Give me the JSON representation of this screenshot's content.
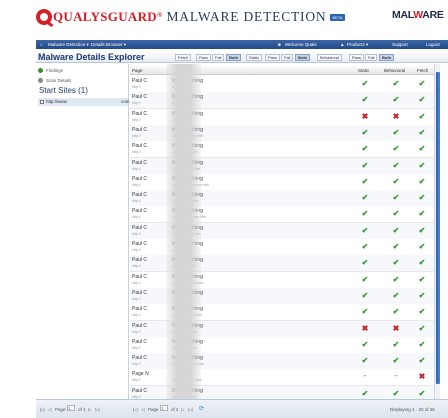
{
  "brand": {
    "name": "QUALYSGUARD",
    "reg": "®",
    "product": "MALWARE DETECTION",
    "beta": "BETA",
    "malware_logo_left": "MAL",
    "malware_logo_mid": "W",
    "malware_logo_right": "ARE"
  },
  "nav": {
    "home_label": "Malware Detection ▾",
    "details_label": "Details Browser ▾",
    "user_label": "Welcome Quals",
    "products_label": "Products ▾",
    "support_label": "Support",
    "logout_label": "Logout"
  },
  "title": "Malware Details Explorer",
  "filters": {
    "group1": [
      "Fetch",
      "Pass",
      "Fail",
      "Both"
    ],
    "group2": [
      "Static",
      "Pass",
      "Fail",
      "Both"
    ],
    "group3": [
      "Behavioral",
      "Pass",
      "Fail",
      "Both"
    ]
  },
  "left_panel": {
    "findings_label": "Findings",
    "scan_details_label": "Scan Details",
    "start_sites_label": "Start Sites (1)",
    "site_label": "http://www",
    "site_suffix": "com"
  },
  "grid": {
    "columns": {
      "page": "Page",
      "static": "Static",
      "behavioral": "Behavioral",
      "fetch": "Fetch"
    },
    "rows": [
      {
        "title": "Paul C",
        "title_suffix": "Metalsmithing",
        "url": "http://",
        "url_suffix": "index.htm",
        "s": "pass",
        "b": "pass",
        "f": "pass"
      },
      {
        "title": "Paul C",
        "title_suffix": "Metalsmithing",
        "url": "http://",
        "url_suffix": "/resume.html",
        "s": "pass",
        "b": "pass",
        "f": "pass"
      },
      {
        "title": "Paul C",
        "title_suffix": "Metalsmithing",
        "url": "http://",
        "url_suffix": "/contact.html",
        "s": "fail",
        "b": "fail",
        "f": "pass"
      },
      {
        "title": "Paul C",
        "title_suffix": "Metalsmithing",
        "url": "http://",
        "url_suffix": "/gallery/caffeine.htm",
        "s": "pass",
        "b": "pass",
        "f": "pass"
      },
      {
        "title": "Paul C",
        "title_suffix": "Metalsmithing",
        "url": "http://",
        "url_suffix": "/gallery/pots.htm",
        "s": "pass",
        "b": "pass",
        "f": "pass"
      },
      {
        "title": "Paul C",
        "title_suffix": "Metalsmithing",
        "url": "http://",
        "url_suffix": "/gallery/plates.htm",
        "s": "pass",
        "b": "pass",
        "f": "pass"
      },
      {
        "title": "Paul C",
        "title_suffix": "Metalsmithing",
        "url": "http://",
        "url_suffix": "/gallery/saltnpepper.htm",
        "s": "pass",
        "b": "pass",
        "f": "pass"
      },
      {
        "title": "Paul C",
        "title_suffix": "Metalsmithing",
        "url": "http://",
        "url_suffix": "/gallery/bowl.htm",
        "s": "pass",
        "b": "pass",
        "f": "pass"
      },
      {
        "title": "Paul C",
        "title_suffix": "Metalsmithing",
        "url": "http://",
        "url_suffix": "/gallery/holloware.htm",
        "s": "pass",
        "b": "pass",
        "f": "pass"
      },
      {
        "title": "Paul C",
        "title_suffix": "Metalsmithing",
        "url": "http://",
        "url_suffix": "/gallery/teaset.htm",
        "s": "pass",
        "b": "pass",
        "f": "pass"
      },
      {
        "title": "Paul C",
        "title_suffix": "Metalsmithing",
        "url": "http://",
        "url_suffix": "/cups.htm",
        "s": "pass",
        "b": "pass",
        "f": "pass"
      },
      {
        "title": "Paul C",
        "title_suffix": "Metalsmithing",
        "url": "http://",
        "url_suffix": "/gallery/jug.htm",
        "s": "pass",
        "b": "pass",
        "f": "pass"
      },
      {
        "title": "Paul C",
        "title_suffix": "Metalsmithing",
        "url": "http://",
        "url_suffix": "/gallery/bracelet.htm",
        "s": "pass",
        "b": "pass",
        "f": "pass"
      },
      {
        "title": "Paul C",
        "title_suffix": "Metalsmithing",
        "url": "http://",
        "url_suffix": "/contact.html",
        "s": "pass",
        "b": "pass",
        "f": "pass"
      },
      {
        "title": "Paul C",
        "title_suffix": "Metalsmithing",
        "url": "http://",
        "url_suffix": "/gallery/jewelry.htm",
        "s": "pass",
        "b": "pass",
        "f": "pass"
      },
      {
        "title": "Paul C",
        "title_suffix": "Metalsmithing",
        "url": "http://",
        "url_suffix": "/gallery/box.htm",
        "s": "fail",
        "b": "fail",
        "f": "pass"
      },
      {
        "title": "Paul C",
        "title_suffix": "Metalsmithing",
        "url": "http://",
        "url_suffix": "/gallery/tray.htm",
        "s": "pass",
        "b": "pass",
        "f": "pass"
      },
      {
        "title": "Paul C",
        "title_suffix": "Metalsmithing",
        "url": "http://",
        "url_suffix": "/gallery/pendant.htm",
        "s": "pass",
        "b": "pass",
        "f": "pass"
      },
      {
        "title": "Page N",
        "title_suffix": "",
        "url": "http://",
        "url_suffix": "/gallery/image.html",
        "s": "na",
        "b": "na",
        "f": "fail"
      },
      {
        "title": "Paul C",
        "title_suffix": "Metalsmithing",
        "url": "http://",
        "url_suffix": "/gallery/ring.htm",
        "s": "pass",
        "b": "pass",
        "f": "pass"
      }
    ]
  },
  "footer": {
    "page_label_left": "Page",
    "page_value_left": "1",
    "of_label_left": "of 1",
    "page_label_mid": "Page",
    "page_value_mid": "1",
    "of_label_mid": "of 2",
    "display_label": "Displaying 1 - 20 of 25",
    "first_left": "|◁",
    "prev_left": "◁",
    "next_left": "▷",
    "last_left": "▷|",
    "first_mid": "|◁",
    "prev_mid": "◁",
    "next_mid": "▷",
    "last_mid": "▷|",
    "refresh": "⟳"
  }
}
